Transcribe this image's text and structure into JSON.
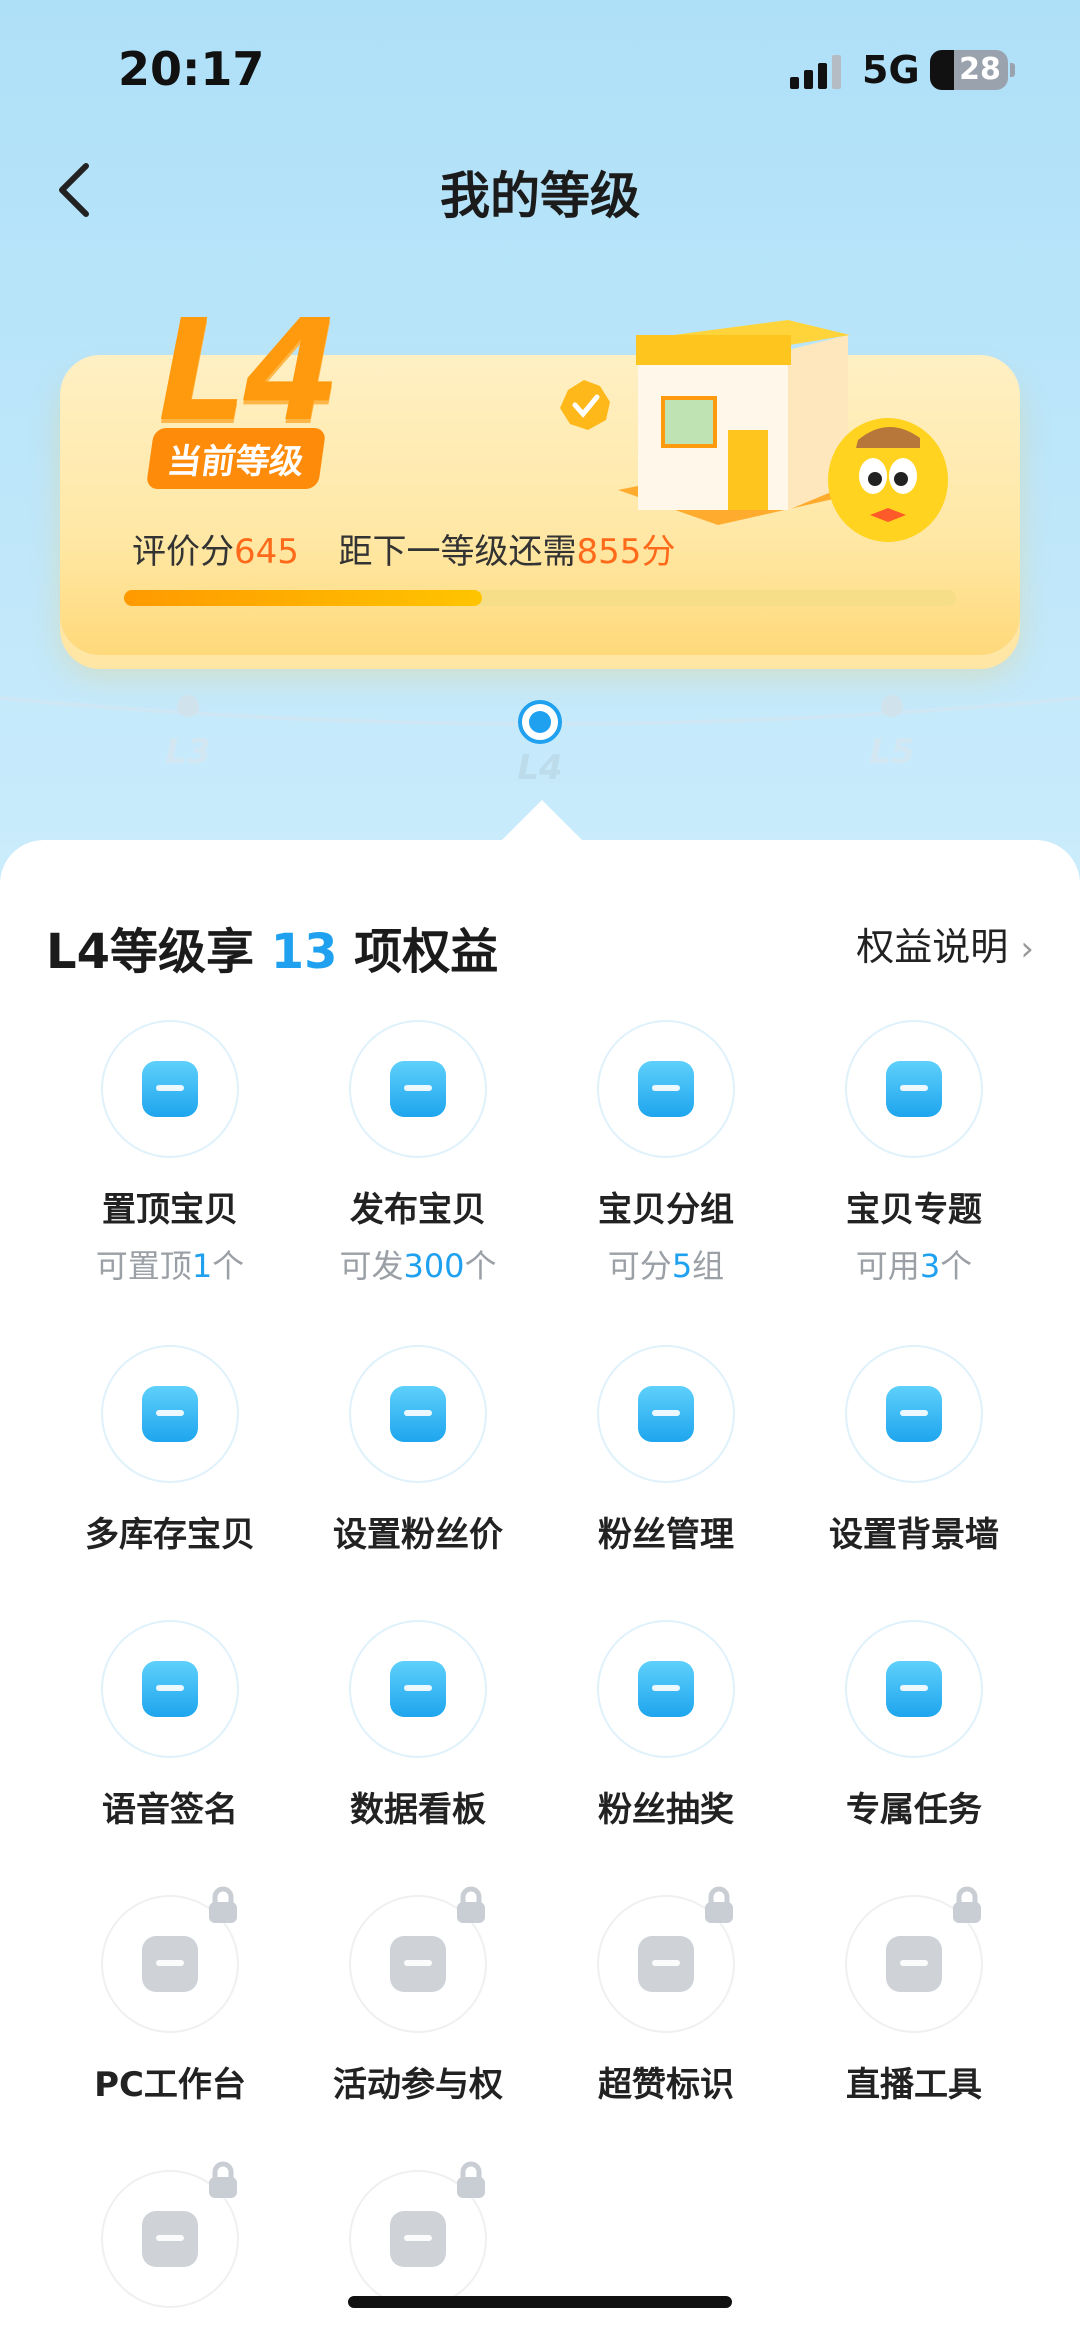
{
  "status_bar": {
    "time": "20:17",
    "network": "5G",
    "battery": "28"
  },
  "header": {
    "title": "我的等级"
  },
  "level_card": {
    "level": "L4",
    "current_badge": "当前等级",
    "score_label": "评价分",
    "score": "645",
    "next_label": "距下一等级还需",
    "next_needed": "855",
    "next_unit": "分",
    "progress_fraction": 0.43
  },
  "timeline": {
    "levels": [
      "L3",
      "L4",
      "L5"
    ],
    "current_index": 1
  },
  "rights": {
    "title_prefix": "L4等级享",
    "count": "13",
    "title_suffix": "项权益",
    "link": "权益说明"
  },
  "items": [
    {
      "name": "置顶宝贝",
      "sub_pre": "可置顶",
      "sub_val": "1",
      "sub_post": "个",
      "icon": "pin-top-icon",
      "locked": false
    },
    {
      "name": "发布宝贝",
      "sub_pre": "可发",
      "sub_val": "300",
      "sub_post": "个",
      "icon": "bag-icon",
      "locked": false
    },
    {
      "name": "宝贝分组",
      "sub_pre": "可分",
      "sub_val": "5",
      "sub_post": "组",
      "icon": "grid-search-icon",
      "locked": false
    },
    {
      "name": "宝贝专题",
      "sub_pre": "可用",
      "sub_val": "3",
      "sub_post": "个",
      "icon": "topic-icon",
      "locked": false
    },
    {
      "name": "多库存宝贝",
      "icon": "multi-bag-icon",
      "locked": false
    },
    {
      "name": "设置粉丝价",
      "icon": "heart-yen-icon",
      "locked": false
    },
    {
      "name": "粉丝管理",
      "icon": "heart-check-icon",
      "locked": false
    },
    {
      "name": "设置背景墙",
      "icon": "image-icon",
      "locked": false
    },
    {
      "name": "语音签名",
      "icon": "mic-icon",
      "locked": false
    },
    {
      "name": "数据看板",
      "icon": "chart-board-icon",
      "locked": false
    },
    {
      "name": "粉丝抽奖",
      "icon": "gift-icon",
      "locked": false
    },
    {
      "name": "专属任务",
      "icon": "shield-check-icon",
      "locked": false
    },
    {
      "name": "PC工作台",
      "icon": "monitor-icon",
      "locked": true
    },
    {
      "name": "活动参与权",
      "icon": "hexagon-key-icon",
      "locked": true
    },
    {
      "name": "超赞标识",
      "icon": "like-badge-icon",
      "locked": true
    },
    {
      "name": "直播工具",
      "icon": "tv-play-icon",
      "locked": true
    },
    {
      "name": "",
      "icon": "qr-code-icon",
      "locked": true
    },
    {
      "name": "",
      "icon": "trophy-icon",
      "locked": true
    }
  ],
  "colors": {
    "accent": "#1fa1f0",
    "orange": "#ff9a0e",
    "highlight": "#ff6a1a"
  }
}
